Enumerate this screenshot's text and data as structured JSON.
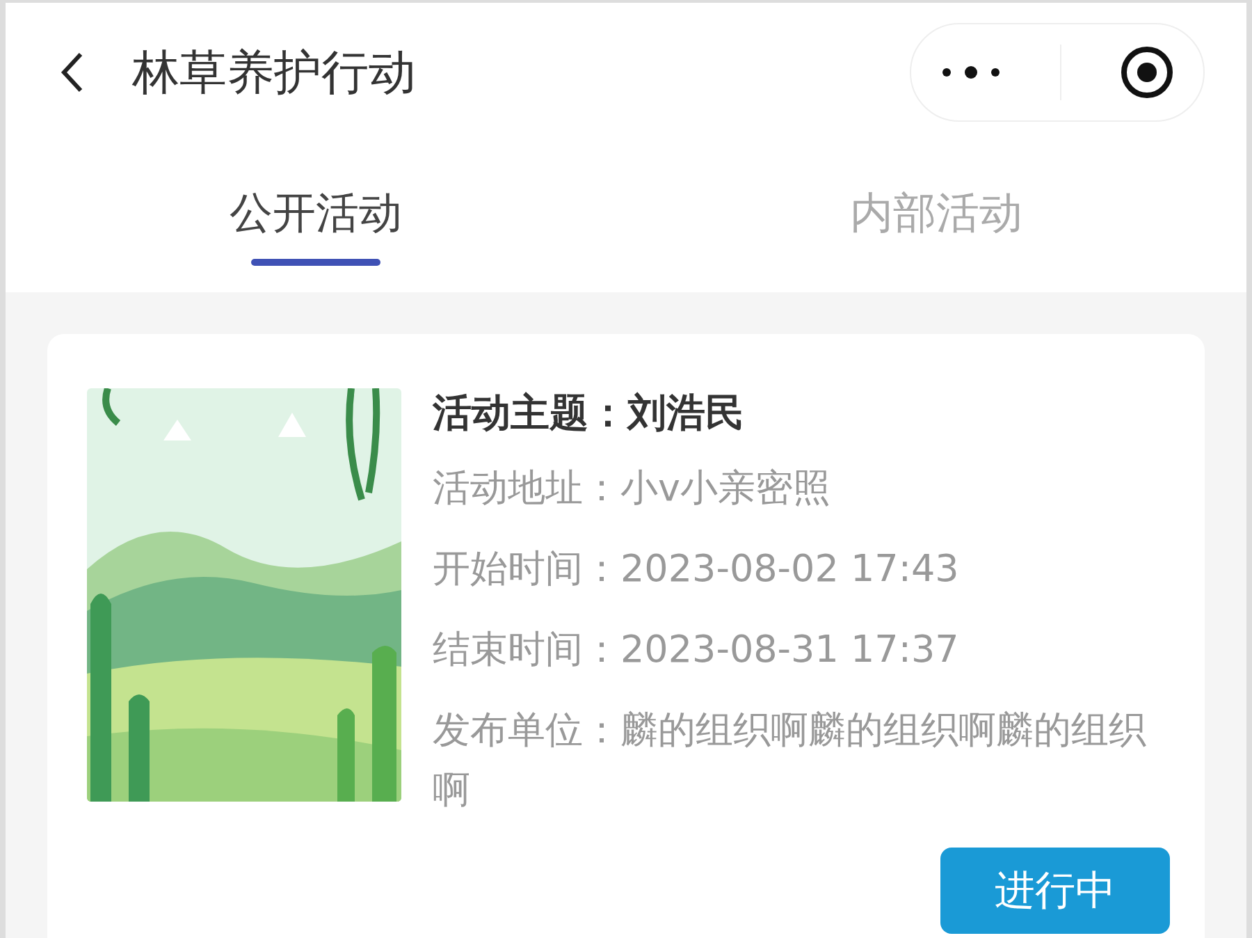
{
  "header": {
    "title": "林草养护行动"
  },
  "tabs": [
    {
      "label": "公开活动",
      "selected": true
    },
    {
      "label": "内部活动",
      "selected": false
    }
  ],
  "card": {
    "subject_label": "活动主题：",
    "subject": "刘浩民",
    "fields": [
      {
        "label": "活动地址：",
        "value": "小v小亲密照"
      },
      {
        "label": "开始时间：",
        "value": "2023-08-02 17:43"
      },
      {
        "label": "结束时间：",
        "value": "2023-08-31 17:37"
      },
      {
        "label": "发布单位：",
        "value": "麟的组织啊麟的组织啊麟的组织啊"
      }
    ],
    "status": "进行中"
  }
}
